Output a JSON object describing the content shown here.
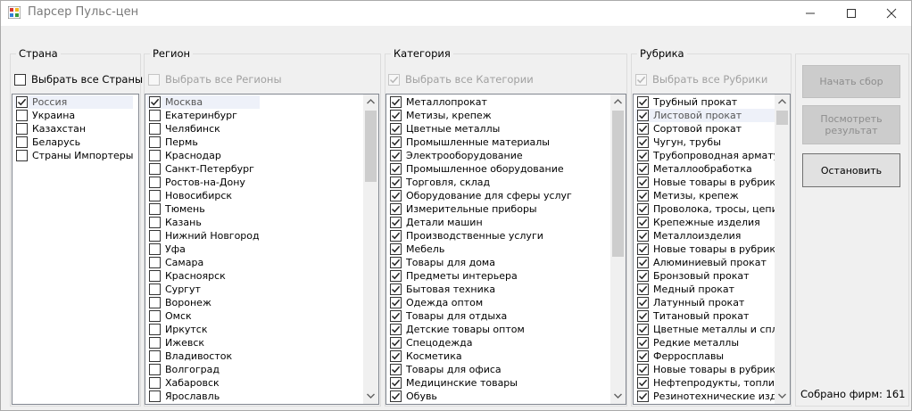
{
  "window": {
    "title": "Парсер Пульс-цен"
  },
  "country": {
    "group_title": "Страна",
    "select_all_label": "Выбрать все Страны",
    "select_all_checked": false,
    "select_all_enabled": true,
    "items": [
      {
        "label": "Россия",
        "checked": true,
        "selected": true
      },
      {
        "label": "Украина",
        "checked": false
      },
      {
        "label": "Казахстан",
        "checked": false
      },
      {
        "label": "Беларусь",
        "checked": false
      },
      {
        "label": "Страны Импортеры",
        "checked": false
      }
    ]
  },
  "region": {
    "group_title": "Регион",
    "select_all_label": "Выбрать все Регионы",
    "select_all_checked": false,
    "select_all_enabled": false,
    "items": [
      {
        "label": "Москва",
        "checked": true,
        "selected": true
      },
      {
        "label": "Екатеринбург",
        "checked": false
      },
      {
        "label": "Челябинск",
        "checked": false
      },
      {
        "label": "Пермь",
        "checked": false
      },
      {
        "label": "Краснодар",
        "checked": false
      },
      {
        "label": "Санкт-Петербург",
        "checked": false
      },
      {
        "label": "Ростов-на-Дону",
        "checked": false
      },
      {
        "label": "Новосибирск",
        "checked": false
      },
      {
        "label": "Тюмень",
        "checked": false
      },
      {
        "label": "Казань",
        "checked": false
      },
      {
        "label": "Нижний Новгород",
        "checked": false
      },
      {
        "label": "Уфа",
        "checked": false
      },
      {
        "label": "Самара",
        "checked": false
      },
      {
        "label": "Красноярск",
        "checked": false
      },
      {
        "label": "Сургут",
        "checked": false
      },
      {
        "label": "Воронеж",
        "checked": false
      },
      {
        "label": "Омск",
        "checked": false
      },
      {
        "label": "Иркутск",
        "checked": false
      },
      {
        "label": "Ижевск",
        "checked": false
      },
      {
        "label": "Владивосток",
        "checked": false
      },
      {
        "label": "Волгоград",
        "checked": false
      },
      {
        "label": "Хабаровск",
        "checked": false
      },
      {
        "label": "Ярославль",
        "checked": false
      }
    ]
  },
  "category": {
    "group_title": "Категория",
    "select_all_label": "Выбрать все Категории",
    "select_all_checked": true,
    "select_all_enabled": false,
    "items": [
      {
        "label": "Металлопрокат",
        "checked": true
      },
      {
        "label": "Метизы, крепеж",
        "checked": true
      },
      {
        "label": "Цветные металлы",
        "checked": true
      },
      {
        "label": "Промышленные материалы",
        "checked": true
      },
      {
        "label": "Электрооборудование",
        "checked": true
      },
      {
        "label": "Промышленное оборудование",
        "checked": true
      },
      {
        "label": "Торговля, склад",
        "checked": true
      },
      {
        "label": "Оборудование для сферы услуг",
        "checked": true
      },
      {
        "label": "Измерительные приборы",
        "checked": true
      },
      {
        "label": "Детали  машин",
        "checked": true
      },
      {
        "label": "Производственные услуги",
        "checked": true
      },
      {
        "label": "Мебель",
        "checked": true
      },
      {
        "label": "Товары для дома",
        "checked": true
      },
      {
        "label": "Предметы интерьера",
        "checked": true
      },
      {
        "label": "Бытовая техника",
        "checked": true
      },
      {
        "label": "Одежда оптом",
        "checked": true
      },
      {
        "label": "Товары для отдыха",
        "checked": true
      },
      {
        "label": "Детские товары оптом",
        "checked": true
      },
      {
        "label": "Спецодежда",
        "checked": true
      },
      {
        "label": "Косметика",
        "checked": true
      },
      {
        "label": "Товары для офиса",
        "checked": true
      },
      {
        "label": "Медицинские товары",
        "checked": true
      },
      {
        "label": "Обувь",
        "checked": true
      }
    ]
  },
  "rubric": {
    "group_title": "Рубрика",
    "select_all_label": "Выбрать все Рубрики",
    "select_all_checked": true,
    "select_all_enabled": false,
    "items": [
      {
        "label": "Трубный прокат",
        "checked": true
      },
      {
        "label": "Листовой прокат",
        "checked": true,
        "selected": true
      },
      {
        "label": "Сортовой прокат",
        "checked": true
      },
      {
        "label": "Чугун, трубы",
        "checked": true
      },
      {
        "label": "Трубопроводная арматура",
        "checked": true
      },
      {
        "label": "Металлообработка",
        "checked": true
      },
      {
        "label": "Новые товары в рубрике М",
        "checked": true
      },
      {
        "label": "Метизы, крепеж",
        "checked": true
      },
      {
        "label": "Проволока, тросы, цепи, се",
        "checked": true
      },
      {
        "label": "Крепежные изделия",
        "checked": true
      },
      {
        "label": "Металлоизделия",
        "checked": true
      },
      {
        "label": "Новые товары в рубрике М",
        "checked": true
      },
      {
        "label": "Алюминиевый прокат",
        "checked": true
      },
      {
        "label": "Бронзовый прокат",
        "checked": true
      },
      {
        "label": "Медный прокат",
        "checked": true
      },
      {
        "label": "Латунный прокат",
        "checked": true
      },
      {
        "label": "Титановый прокат",
        "checked": true
      },
      {
        "label": "Цветные металлы и сплавь",
        "checked": true
      },
      {
        "label": "Редкие металлы",
        "checked": true
      },
      {
        "label": "Ферросплавы",
        "checked": true
      },
      {
        "label": "Новые товары в рубрике Ц",
        "checked": true
      },
      {
        "label": "Нефтепродукты, топливо, Г",
        "checked": true
      },
      {
        "label": "Резинотехнические издели",
        "checked": true
      }
    ]
  },
  "buttons": {
    "start_label": "Начать сбор",
    "view_label": "Посмотреть\nрезультат",
    "stop_label": "Остановить"
  },
  "status": {
    "text": "Собрано фирм: 161"
  },
  "icons": {
    "app": "app-icon",
    "minimize": "minimize-icon",
    "maximize": "maximize-icon",
    "close": "close-icon",
    "check": "checkmark-icon",
    "scroll_up": "chevron-up-icon",
    "scroll_down": "chevron-down-icon"
  }
}
